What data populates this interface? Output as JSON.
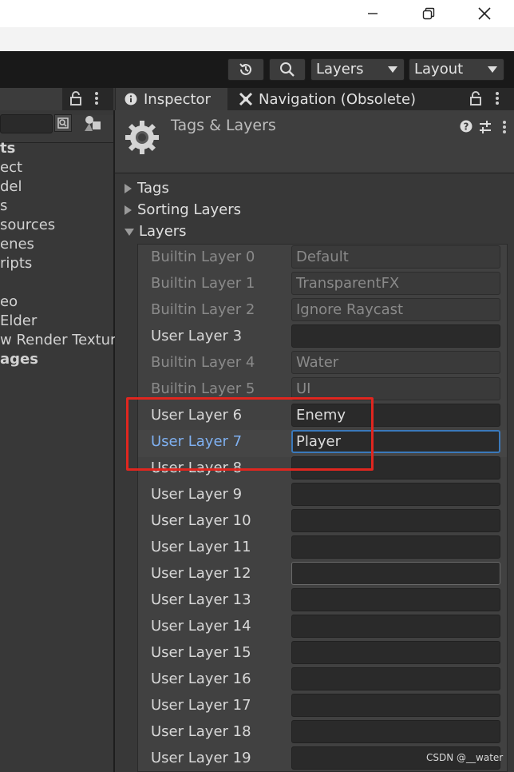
{
  "window": {
    "minimize_icon": "minimize-icon",
    "restore_icon": "restore-icon",
    "close_icon": "close-icon"
  },
  "toolbar": {
    "history_icon": "history-icon",
    "search_icon": "search-icon",
    "layers_dropdown": "Layers",
    "layout_dropdown": "Layout"
  },
  "left_panel": {
    "items": [
      "ts",
      "ect",
      "del",
      "s",
      "sources",
      "enes",
      "ripts",
      "",
      "eo",
      "Elder",
      "w Render Textur",
      "ages"
    ]
  },
  "tabs": {
    "inspector": "Inspector",
    "navigation": "Navigation (Obsolete)"
  },
  "inspector": {
    "title": "Tags & Layers",
    "foldouts": {
      "tags": "Tags",
      "sorting_layers": "Sorting Layers",
      "layers": "Layers"
    },
    "layers": [
      {
        "label": "Builtin Layer 0",
        "value": "Default"
      },
      {
        "label": "Builtin Layer 1",
        "value": "TransparentFX"
      },
      {
        "label": "Builtin Layer 2",
        "value": "Ignore Raycast"
      },
      {
        "label": "User Layer 3",
        "value": ""
      },
      {
        "label": "Builtin Layer 4",
        "value": "Water"
      },
      {
        "label": "Builtin Layer 5",
        "value": "UI"
      },
      {
        "label": "User Layer 6",
        "value": "Enemy"
      },
      {
        "label": "User Layer 7",
        "value": "Player"
      },
      {
        "label": "User Layer 8",
        "value": ""
      },
      {
        "label": "User Layer 9",
        "value": ""
      },
      {
        "label": "User Layer 10",
        "value": ""
      },
      {
        "label": "User Layer 11",
        "value": ""
      },
      {
        "label": "User Layer 12",
        "value": ""
      },
      {
        "label": "User Layer 13",
        "value": ""
      },
      {
        "label": "User Layer 14",
        "value": ""
      },
      {
        "label": "User Layer 15",
        "value": ""
      },
      {
        "label": "User Layer 16",
        "value": ""
      },
      {
        "label": "User Layer 17",
        "value": ""
      },
      {
        "label": "User Layer 18",
        "value": ""
      },
      {
        "label": "User Layer 19",
        "value": ""
      }
    ]
  },
  "watermark": "CSDN @__water",
  "colors": {
    "accent_blue": "#3a79bb",
    "selected_label": "#7fb0f0",
    "annotation_red": "#e0261f"
  }
}
